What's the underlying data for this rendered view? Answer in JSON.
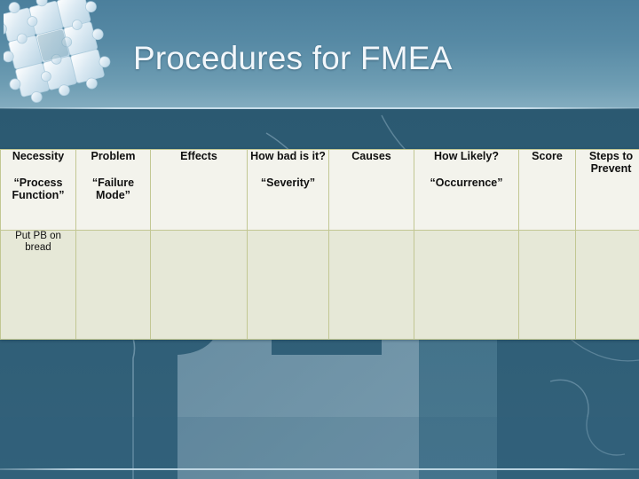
{
  "slide": {
    "title": "Procedures for FMEA",
    "logo_icon": "jigsaw-puzzle-icon",
    "background_icon": "puzzle-piece-background",
    "colors": {
      "header_band": "#578aa5",
      "body_background": "#2e5d77",
      "table_header_fill": "#f3f3ec",
      "table_body_fill": "#e6e8d7",
      "table_border": "#c2c793",
      "title_text": "#f2f7fb"
    }
  },
  "table": {
    "columns": [
      {
        "heading": "Necessity",
        "alt_heading": "“Process Function”"
      },
      {
        "heading": "Problem",
        "alt_heading": "“Failure Mode”"
      },
      {
        "heading": "Effects",
        "alt_heading": ""
      },
      {
        "heading": "How bad is it?",
        "alt_heading": "“Severity”"
      },
      {
        "heading": "Causes",
        "alt_heading": ""
      },
      {
        "heading": "How Likely?",
        "alt_heading": "“Occurrence”"
      },
      {
        "heading": "Score",
        "alt_heading": ""
      },
      {
        "heading": "Steps to Prevent",
        "alt_heading": ""
      }
    ],
    "rows": [
      {
        "cells": [
          "Put PB on bread",
          "",
          "",
          "",
          "",
          "",
          "",
          ""
        ]
      }
    ]
  }
}
